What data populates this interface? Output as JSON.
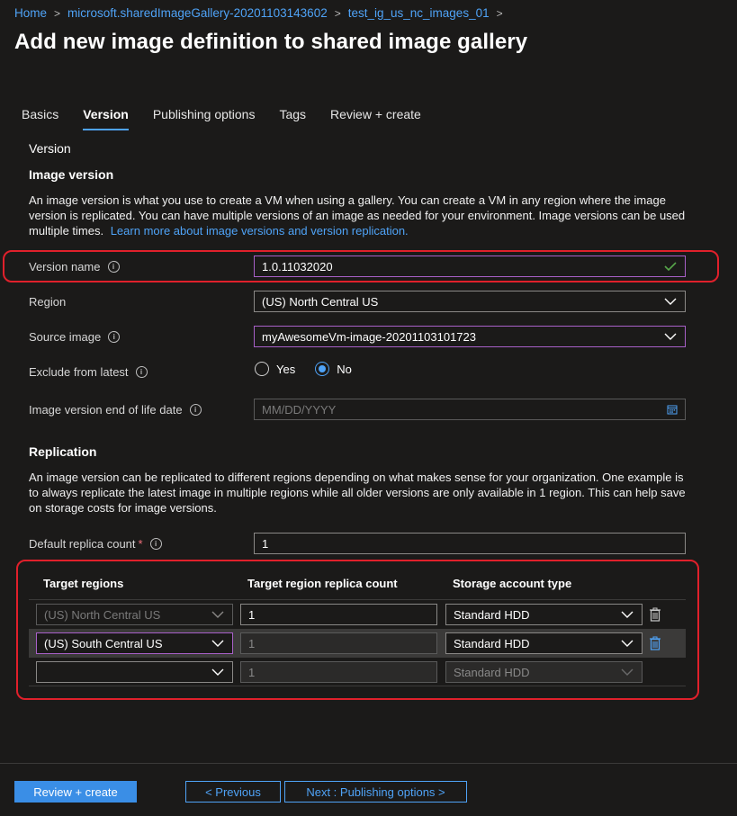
{
  "breadcrumb": {
    "items": [
      "Home",
      "microsoft.sharedImageGallery-20201103143602",
      "test_ig_us_nc_images_01"
    ],
    "separator": ">"
  },
  "page": {
    "title": "Add new image definition to shared image gallery"
  },
  "tabs": [
    {
      "label": "Basics",
      "active": false
    },
    {
      "label": "Version",
      "active": true
    },
    {
      "label": "Publishing options",
      "active": false
    },
    {
      "label": "Tags",
      "active": false
    },
    {
      "label": "Review + create",
      "active": false
    }
  ],
  "version_section": {
    "label": "Version",
    "heading": "Image version",
    "description": "An image version is what you use to create a VM when using a gallery. You can create a VM in any region where the image version is replicated. You can have multiple versions of an image as needed for your environment. Image versions can be used multiple times.",
    "learn_more": "Learn more about image versions and version replication."
  },
  "fields": {
    "version_name": {
      "label": "Version name",
      "value": "1.0.11032020"
    },
    "region": {
      "label": "Region",
      "value": "(US) North Central US"
    },
    "source_image": {
      "label": "Source image",
      "value": "myAwesomeVm-image-20201103101723"
    },
    "exclude_from_latest": {
      "label": "Exclude from latest",
      "options": [
        "Yes",
        "No"
      ],
      "selected": "No"
    },
    "end_of_life": {
      "label": "Image version end of life date",
      "placeholder": "MM/DD/YYYY"
    }
  },
  "replication": {
    "heading": "Replication",
    "description": "An image version can be replicated to different regions depending on what makes sense for your organization. One example is to always replicate the latest image in multiple regions while all older versions are only available in 1 region. This can help save on storage costs for image versions.",
    "default_replica_label": "Default replica count",
    "default_replica_value": "1",
    "required_mark": "*",
    "columns": [
      "Target regions",
      "Target region replica count",
      "Storage account type"
    ],
    "rows": [
      {
        "region": "(US) North Central US",
        "count": "1",
        "storage": "Standard HDD"
      },
      {
        "region": "(US) South Central US",
        "count": "1",
        "storage": "Standard HDD"
      },
      {
        "region": "",
        "count": "1",
        "storage": "Standard HDD"
      }
    ]
  },
  "footer": {
    "review_create": "Review + create",
    "previous": "< Previous",
    "next": "Next : Publishing options >"
  },
  "colors": {
    "background": "#1b1a19",
    "accent": "#4fa3f7",
    "highlight_box": "#e0202b",
    "valid_check": "#57a64a"
  }
}
